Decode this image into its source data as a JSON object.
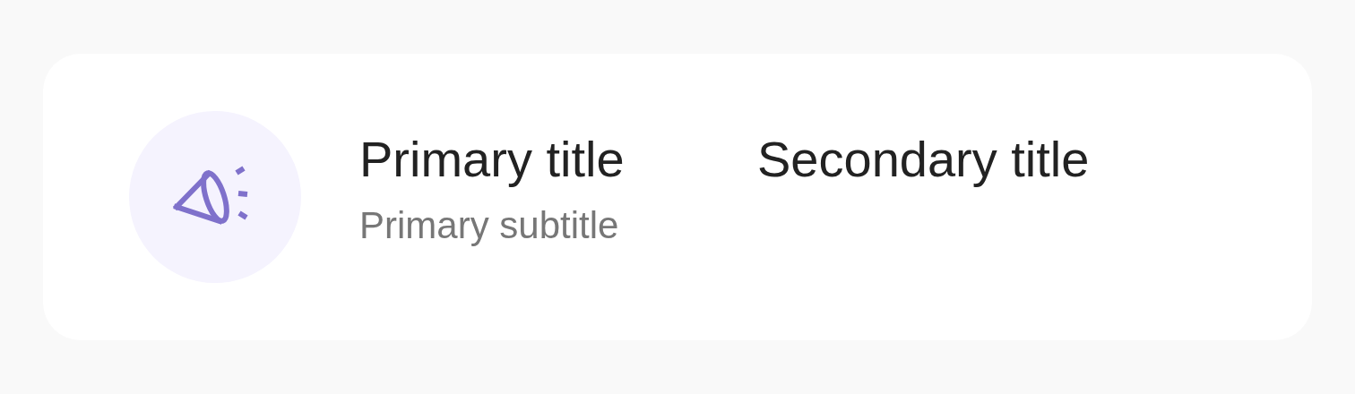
{
  "item": {
    "title": "Primary title",
    "subtitle": "Primary subtitle",
    "secondary_title": "Secondary title"
  }
}
